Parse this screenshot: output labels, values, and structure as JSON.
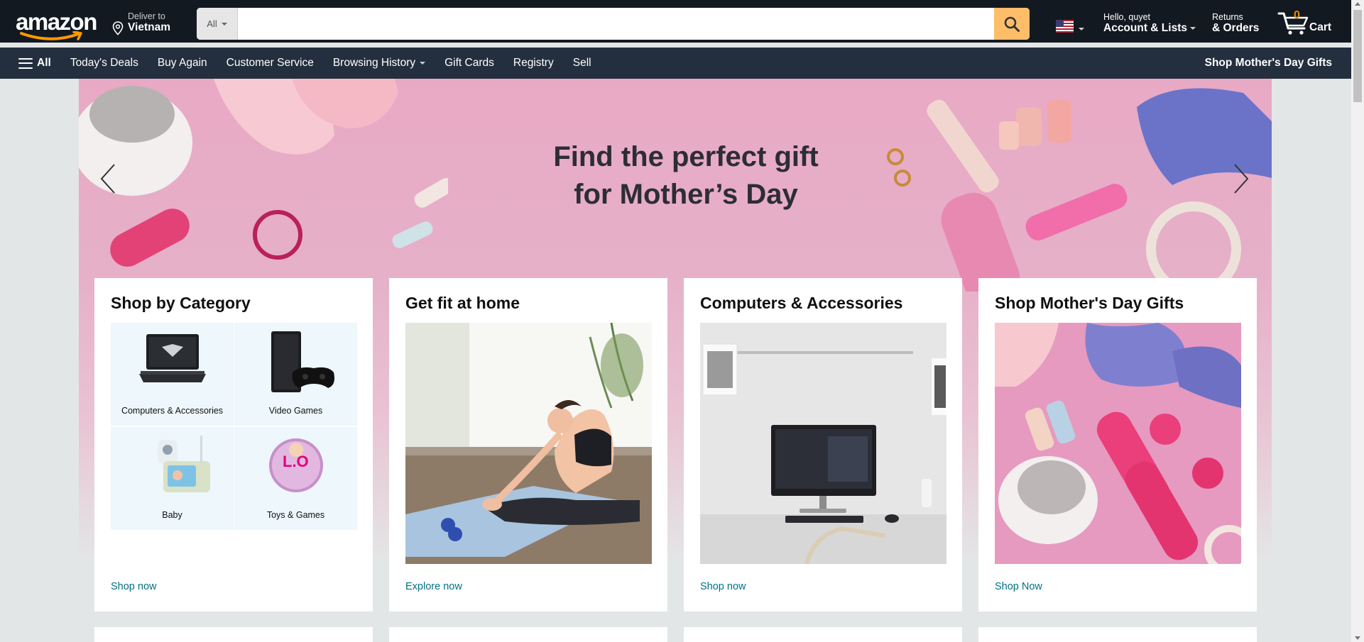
{
  "header": {
    "logo_text": "amazon",
    "deliver": {
      "line1": "Deliver to",
      "line2": "Vietnam"
    },
    "search": {
      "category": "All",
      "placeholder": ""
    },
    "account": {
      "line1": "Hello, quyet",
      "line2": "Account & Lists"
    },
    "returns": {
      "line1": "Returns",
      "line2": "& Orders"
    },
    "cart": {
      "count": "0",
      "label": "Cart"
    }
  },
  "subnav": {
    "all": "All",
    "items": [
      "Today's Deals",
      "Buy Again",
      "Customer Service",
      "Browsing History",
      "Gift Cards",
      "Registry",
      "Sell"
    ],
    "promo": "Shop Mother's Day Gifts"
  },
  "hero": {
    "line1": "Find the perfect gift",
    "line2": "for Mother’s Day"
  },
  "cards": [
    {
      "title": "Shop by Category",
      "link": "Shop now",
      "categories": [
        "Computers & Accessories",
        "Video Games",
        "Baby",
        "Toys & Games"
      ]
    },
    {
      "title": "Get fit at home",
      "link": "Explore now"
    },
    {
      "title": "Computers & Accessories",
      "link": "Shop now"
    },
    {
      "title": "Shop Mother's Day Gifts",
      "link": "Shop Now"
    }
  ],
  "colors": {
    "nav_dark": "#131921",
    "nav_sub": "#232f3e",
    "search_button": "#febd69",
    "cart_count": "#f08804",
    "link": "#007185",
    "hero_pink": "#e8a9c4"
  },
  "icons": [
    "location-pin-icon",
    "search-icon",
    "us-flag-icon",
    "cart-icon",
    "hamburger-icon",
    "chevron-left-icon",
    "chevron-right-icon"
  ]
}
